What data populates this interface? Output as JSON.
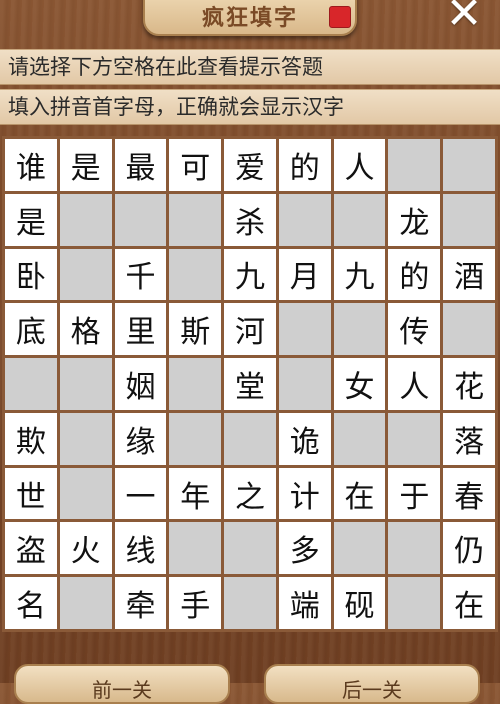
{
  "header": {
    "title": "疯狂填字",
    "close_symbol": "✕"
  },
  "hints": {
    "line1": "请选择下方空格在此查看提示答题",
    "line2": "填入拼音首字母，正确就会显示汉字"
  },
  "grid": [
    [
      "谁",
      "是",
      "最",
      "可",
      "爱",
      "的",
      "人",
      "",
      ""
    ],
    [
      "是",
      "",
      "",
      "",
      "杀",
      "",
      "",
      "龙",
      ""
    ],
    [
      "卧",
      "",
      "千",
      "",
      "九",
      "月",
      "九",
      "的",
      "酒"
    ],
    [
      "底",
      "格",
      "里",
      "斯",
      "河",
      "",
      "",
      "传",
      ""
    ],
    [
      "",
      "",
      "姻",
      "",
      "堂",
      "",
      "女",
      "人",
      "花"
    ],
    [
      "欺",
      "",
      "缘",
      "",
      "",
      "诡",
      "",
      "",
      "落"
    ],
    [
      "世",
      "",
      "一",
      "年",
      "之",
      "计",
      "在",
      "于",
      "春"
    ],
    [
      "盗",
      "火",
      "线",
      "",
      "",
      "多",
      "",
      "",
      "仍"
    ],
    [
      "名",
      "",
      "牵",
      "手",
      "",
      "端",
      "砚",
      "",
      "在"
    ]
  ],
  "grid_blocked": [
    [
      0,
      0,
      0,
      0,
      0,
      0,
      0,
      1,
      1
    ],
    [
      0,
      1,
      1,
      1,
      0,
      1,
      1,
      0,
      1
    ],
    [
      0,
      1,
      0,
      1,
      0,
      0,
      0,
      0,
      0
    ],
    [
      0,
      0,
      0,
      0,
      0,
      1,
      1,
      0,
      1
    ],
    [
      1,
      1,
      0,
      1,
      0,
      1,
      0,
      0,
      0
    ],
    [
      0,
      1,
      0,
      1,
      1,
      0,
      1,
      1,
      0
    ],
    [
      0,
      1,
      0,
      0,
      0,
      0,
      0,
      0,
      0
    ],
    [
      0,
      0,
      0,
      1,
      1,
      0,
      1,
      1,
      0
    ],
    [
      0,
      1,
      0,
      0,
      1,
      0,
      0,
      1,
      0
    ]
  ],
  "buttons": {
    "prev": "前一关",
    "next": "后一关"
  },
  "colors": {
    "cell_white": "#ffffff",
    "cell_blocked": "#cfcfcf",
    "wood": "#7a4828"
  }
}
